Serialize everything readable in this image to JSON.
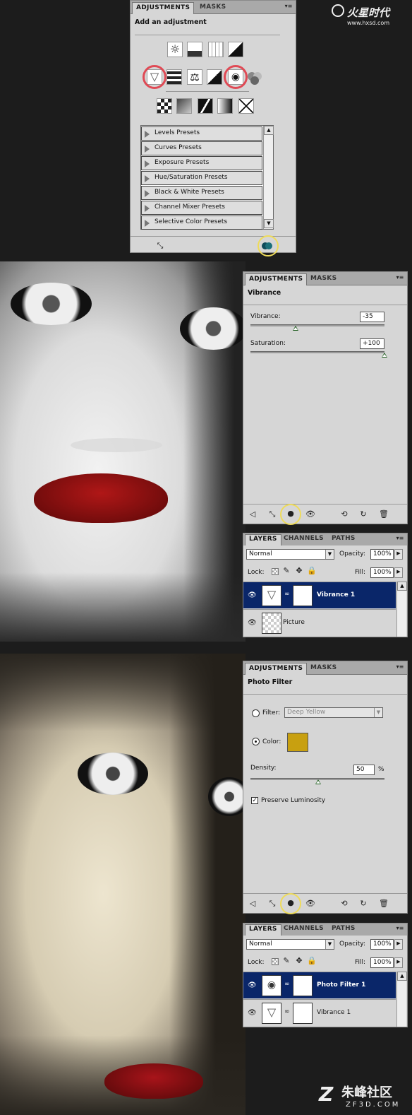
{
  "watermark_top": {
    "brand": "火星时代",
    "url": "www.hxsd.com"
  },
  "watermark_bottom": {
    "brand": "朱峰社区",
    "url": "ZF3D.COM"
  },
  "panel1": {
    "tabs": [
      "ADJUSTMENTS",
      "MASKS"
    ],
    "menu_icon": "▾≡",
    "title": "Add an adjustment",
    "presets": [
      "Levels Presets",
      "Curves Presets",
      "Exposure Presets",
      "Hue/Saturation Presets",
      "Black & White Presets",
      "Channel Mixer Presets",
      "Selective Color Presets"
    ]
  },
  "panel2": {
    "tabs": [
      "ADJUSTMENTS",
      "MASKS"
    ],
    "title": "Vibrance",
    "vibrance_label": "Vibrance:",
    "vibrance_value": "-35",
    "saturation_label": "Saturation:",
    "saturation_value": "+100"
  },
  "layers1": {
    "tabs": [
      "LAYERS",
      "CHANNELS",
      "PATHS"
    ],
    "blend_mode": "Normal",
    "opacity_label": "Opacity:",
    "opacity_value": "100%",
    "lock_label": "Lock:",
    "fill_label": "Fill:",
    "fill_value": "100%",
    "layers": [
      "Vibrance 1",
      "Picture"
    ]
  },
  "panel3": {
    "tabs": [
      "ADJUSTMENTS",
      "MASKS"
    ],
    "title": "Photo Filter",
    "filter_label": "Filter:",
    "filter_value": "Deep Yellow",
    "color_label": "Color:",
    "color_swatch": "#c8a010",
    "density_label": "Density:",
    "density_value": "50",
    "density_unit": "%",
    "preserve_label": "Preserve Luminosity"
  },
  "layers2": {
    "tabs": [
      "LAYERS",
      "CHANNELS",
      "PATHS"
    ],
    "blend_mode": "Normal",
    "opacity_label": "Opacity:",
    "opacity_value": "100%",
    "lock_label": "Lock:",
    "fill_label": "Fill:",
    "fill_value": "100%",
    "layers": [
      "Photo Filter 1",
      "Vibrance 1"
    ]
  }
}
